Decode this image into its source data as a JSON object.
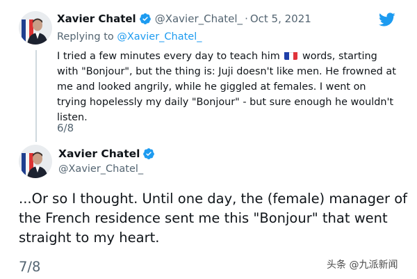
{
  "tweet1": {
    "author_name": "Xavier Chatel",
    "handle": "@Xavier_Chatel_",
    "separator": "·",
    "date": "Oct 5, 2021",
    "reply_prefix": "Replying to",
    "reply_mention": "@Xavier_Chatel_",
    "text_before_flag": "I tried a few minutes every day to teach him",
    "flag_icon": "france-flag-icon",
    "text_after_flag": "words, starting with \"Bonjour\", but the thing is: Juji doesn't like men. He frowned at me and looked angrily, while he giggled at females. I went on trying hopelessly my daily \"Bonjour\" - but sure enough he wouldn't listen.",
    "thread_count": "6/8"
  },
  "tweet2": {
    "author_name": "Xavier Chatel",
    "handle": "@Xavier_Chatel_",
    "text": "...Or so I thought. Until one day, the (female)  manager of the French residence sent me this \"Bonjour\" that went straight to my heart.",
    "thread_count": "7/8"
  },
  "watermark": "头条 @九派新闻",
  "icons": {
    "brand": "twitter-bird-icon",
    "verified": "verified-badge-icon"
  },
  "colors": {
    "twitter_blue": "#1d9bf0",
    "secondary_text": "#536471",
    "primary_text": "#0f1419",
    "thread_line": "#cfd9de"
  }
}
